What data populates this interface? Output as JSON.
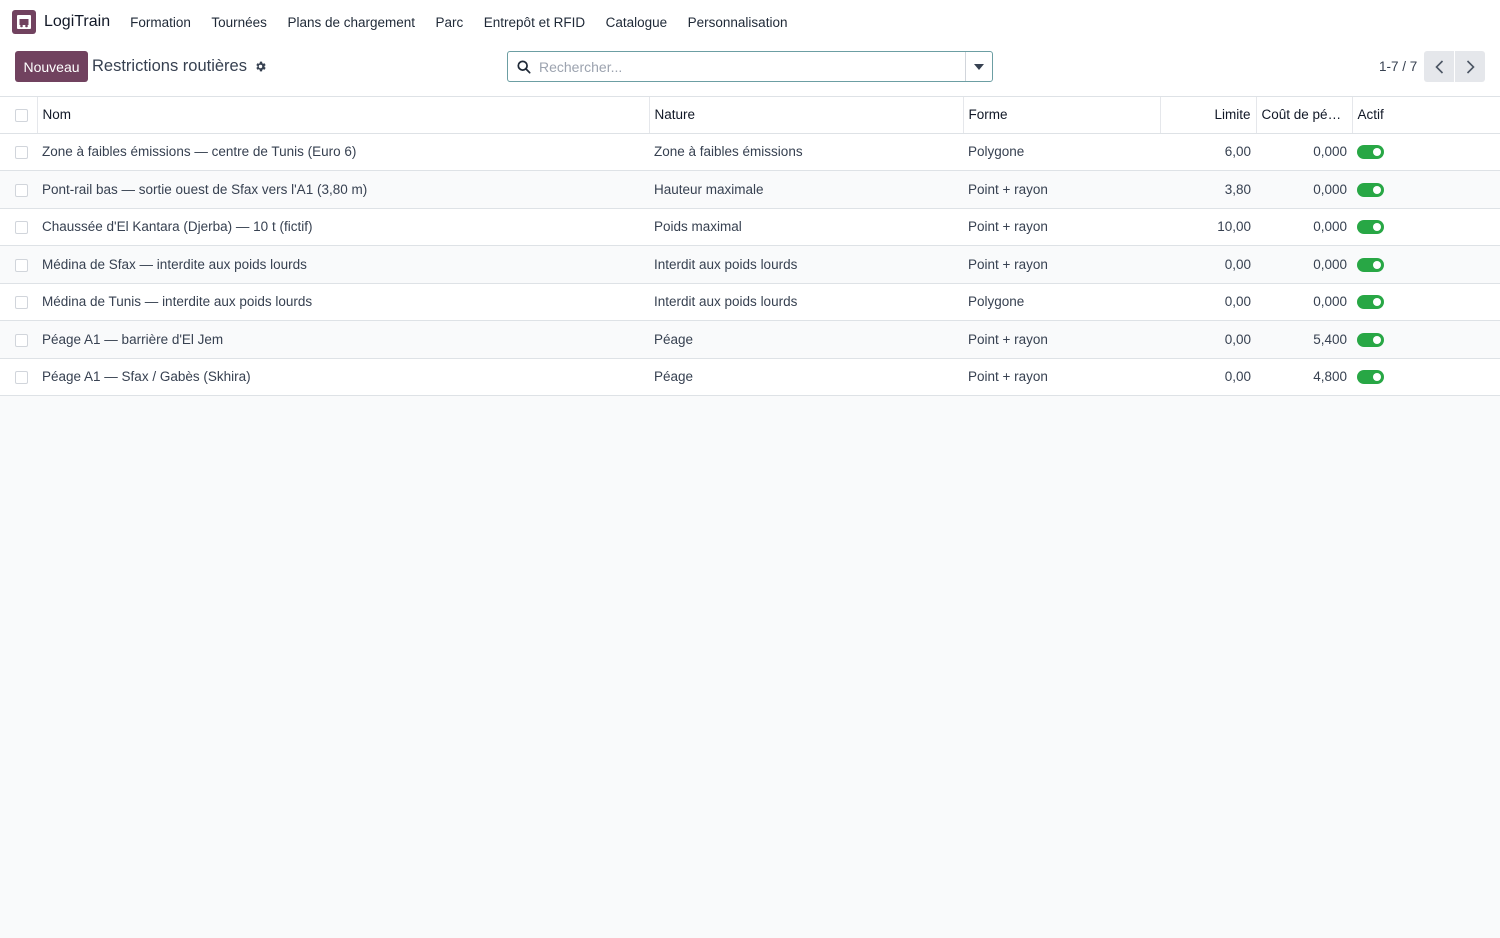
{
  "app": {
    "name": "LogiTrain",
    "menu": [
      "Formation",
      "Tournées",
      "Plans de chargement",
      "Parc",
      "Entrepôt et RFID",
      "Catalogue",
      "Personnalisation"
    ]
  },
  "control": {
    "new_label": "Nouveau",
    "title": "Restrictions routières",
    "search_placeholder": "Rechercher...",
    "pager": "1-7 / 7"
  },
  "table": {
    "columns": [
      "Nom",
      "Nature",
      "Forme",
      "Limite",
      "Coût de péa…",
      "Actif"
    ],
    "rows": [
      {
        "nom": "Zone à faibles émissions — centre de Tunis (Euro 6)",
        "nature": "Zone à faibles émissions",
        "forme": "Polygone",
        "limite": "6,00",
        "cout": "0,000",
        "actif": true
      },
      {
        "nom": "Pont-rail bas — sortie ouest de Sfax vers l'A1 (3,80 m)",
        "nature": "Hauteur maximale",
        "forme": "Point + rayon",
        "limite": "3,80",
        "cout": "0,000",
        "actif": true
      },
      {
        "nom": "Chaussée d'El Kantara (Djerba) — 10 t (fictif)",
        "nature": "Poids maximal",
        "forme": "Point + rayon",
        "limite": "10,00",
        "cout": "0,000",
        "actif": true
      },
      {
        "nom": "Médina de Sfax — interdite aux poids lourds",
        "nature": "Interdit aux poids lourds",
        "forme": "Point + rayon",
        "limite": "0,00",
        "cout": "0,000",
        "actif": true
      },
      {
        "nom": "Médina de Tunis — interdite aux poids lourds",
        "nature": "Interdit aux poids lourds",
        "forme": "Polygone",
        "limite": "0,00",
        "cout": "0,000",
        "actif": true
      },
      {
        "nom": "Péage A1 — barrière d'El Jem",
        "nature": "Péage",
        "forme": "Point + rayon",
        "limite": "0,00",
        "cout": "5,400",
        "actif": true
      },
      {
        "nom": "Péage A1 — Sfax / Gabès (Skhira)",
        "nature": "Péage",
        "forme": "Point + rayon",
        "limite": "0,00",
        "cout": "4,800",
        "actif": true
      }
    ]
  },
  "colors": {
    "brand": "#71425f",
    "toggle_on": "#28a745",
    "search_border": "#6c9ea3"
  },
  "icons": [
    "app-logo-icon",
    "gear-icon",
    "search-icon",
    "caret-down-icon",
    "chevron-left-icon",
    "chevron-right-icon"
  ]
}
